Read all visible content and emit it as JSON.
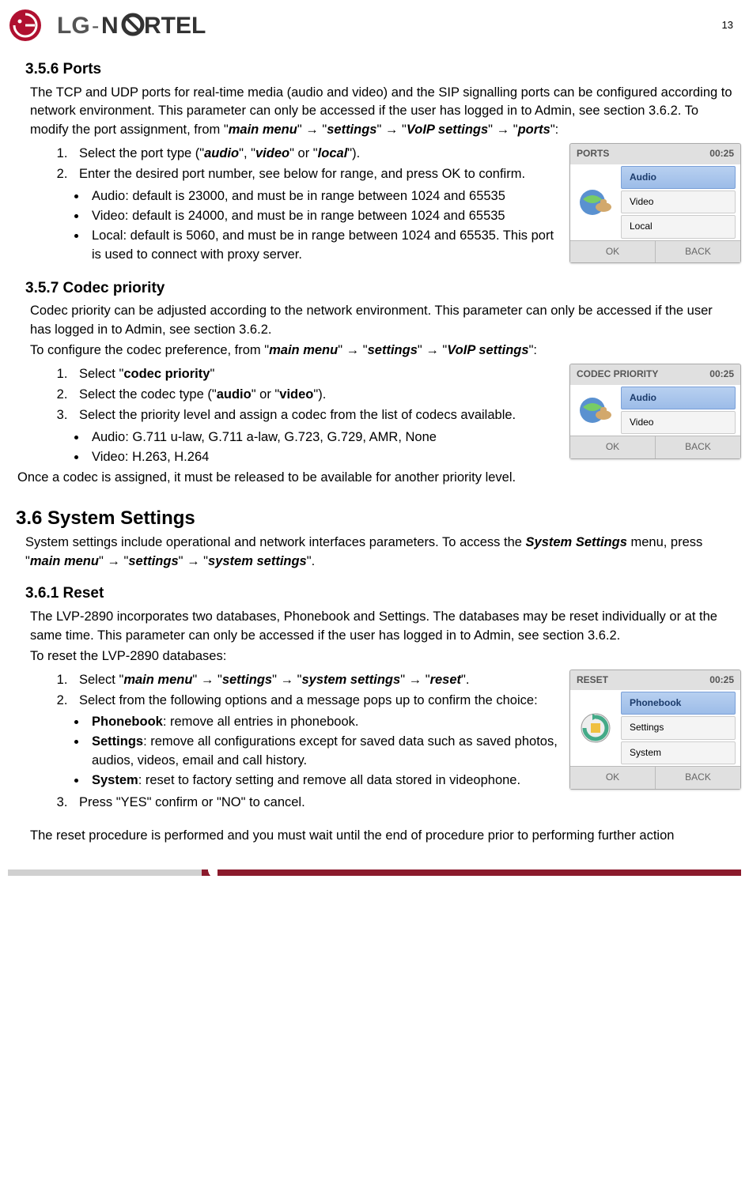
{
  "header": {
    "page_number": "13"
  },
  "section_356": {
    "heading": "3.5.6    Ports",
    "intro_pre": "The TCP and UDP ports for real-time media (audio and video) and the SIP signalling ports can be configured according to network environment.  This parameter can only be accessed if the user has logged in to Admin, see section 3.6.2.  To modify the port assignment, from \"",
    "mm": "main menu",
    "arrow": "\" → \"",
    "settings": "settings",
    "voip": "VoIP settings",
    "ports": "ports",
    "intro_post": "\":",
    "step1_pre": "Select the port type (\"",
    "audio": "audio",
    "sep1": "\", \"",
    "video": "video",
    "sep2": "\" or \"",
    "local": "local",
    "step1_post": "\").",
    "step2": "Enter the desired port number, see below for range, and press OK to confirm.",
    "b1": "Audio: default is 23000, and must be in range between 1024 and 65535",
    "b2": "Video: default is 24000, and must be in range between 1024 and 65535",
    "b3": "Local: default is 5060, and must be in range between 1024 and 65535. This port is used to connect with proxy server."
  },
  "widget_ports": {
    "title": "PORTS",
    "time": "00:25",
    "items": [
      "Audio",
      "Video",
      "Local"
    ],
    "ok": "OK",
    "back": "BACK"
  },
  "section_357": {
    "heading": "3.5.7    Codec priority",
    "p1": "Codec priority can be adjusted according to the network environment.  This parameter can only be accessed if the user has logged in to Admin, see section 3.6.2.",
    "p2_pre": "To configure the codec preference, from \"",
    "mm": "main menu",
    "arrow": "\" → \"",
    "settings": "settings",
    "voip": "VoIP settings",
    "p2_post": "\":",
    "s1_pre": "Select \"",
    "cp": "codec priority",
    "s1_post": "\"",
    "s2_pre": "Select the codec type (\"",
    "audio": "audio",
    "sep": "\" or \"",
    "video": "video",
    "s2_post": "\").",
    "s3": "Select the priority level and assign a codec from the list of codecs available.",
    "b1": "Audio: G.711 u-law, G.711 a-law, G.723, G.729, AMR, None",
    "b2": "Video: H.263, H.264",
    "tail": "Once a codec is assigned, it must be released to be available for another priority level."
  },
  "widget_codec": {
    "title": "CODEC PRIORITY",
    "time": "00:25",
    "items": [
      "Audio",
      "Video"
    ],
    "ok": "OK",
    "back": "BACK"
  },
  "section_36": {
    "heading": "3.6    System Settings",
    "p_pre": "System settings include operational and network interfaces parameters.  To access the ",
    "ss": "System Settings",
    "p_mid": " menu, press \"",
    "mm": "main menu",
    "arrow": "\" → \"",
    "settings": "settings",
    "sys": "system settings",
    "p_post": "\"."
  },
  "section_361": {
    "heading": "3.6.1    Reset",
    "p1": "The LVP-2890 incorporates two databases, Phonebook and Settings.  The databases may be reset individually or at the same time.  This parameter can only be accessed if the user has logged in to Admin, see section 3.6.2.",
    "p2": "To reset the LVP-2890 databases:",
    "s1_pre": "Select \"",
    "mm": "main menu",
    "arrow": "\" → \"",
    "settings": "settings",
    "sys": "system settings",
    "reset": "reset",
    "s1_post": "\".",
    "s2": "Select from the following options and a message pops up to confirm the choice:",
    "b1_b": "Phonebook",
    "b1_t": ": remove all entries in phonebook.",
    "b2_b": "Settings",
    "b2_t": ": remove all configurations except for saved data such as saved photos, audios, videos, email and call history.",
    "b3_b": "System",
    "b3_t": ": reset to factory setting and remove all data stored in videophone.",
    "s3": "Press \"YES\" confirm or \"NO\" to cancel.",
    "tail": "The reset procedure is performed and you must wait until the end of procedure prior to performing further action"
  },
  "widget_reset": {
    "title": "RESET",
    "time": "00:25",
    "items": [
      "Phonebook",
      "Settings",
      "System"
    ],
    "ok": "OK",
    "back": "BACK"
  }
}
